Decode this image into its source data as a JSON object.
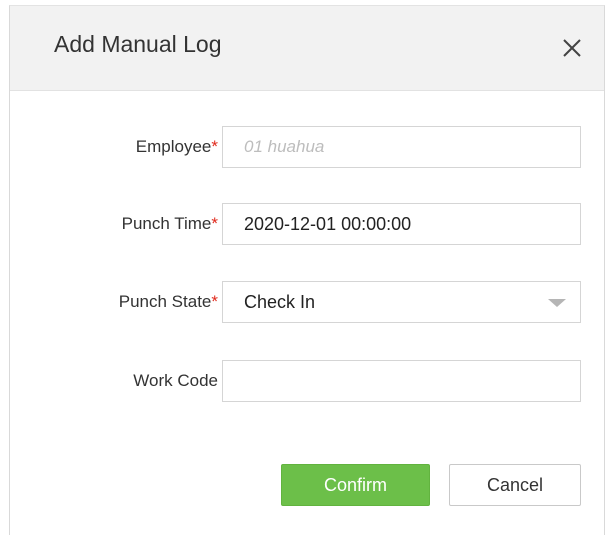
{
  "dialog": {
    "title": "Add Manual Log",
    "close_icon": "close-icon"
  },
  "form": {
    "employee": {
      "label": "Employee",
      "required_mark": "*",
      "value": "01 huahua"
    },
    "punch_time": {
      "label": "Punch Time",
      "required_mark": "*",
      "value": "2020-12-01 00:00:00"
    },
    "punch_state": {
      "label": "Punch State",
      "required_mark": "*",
      "value": "Check In",
      "icon": "chevron-down-icon"
    },
    "work_code": {
      "label": "Work Code",
      "value": ""
    }
  },
  "buttons": {
    "confirm_label": "Confirm",
    "cancel_label": "Cancel"
  },
  "colors": {
    "required": "#e0281b",
    "confirm_bg": "#6cbf49",
    "header_bg": "#f2f2f2"
  }
}
